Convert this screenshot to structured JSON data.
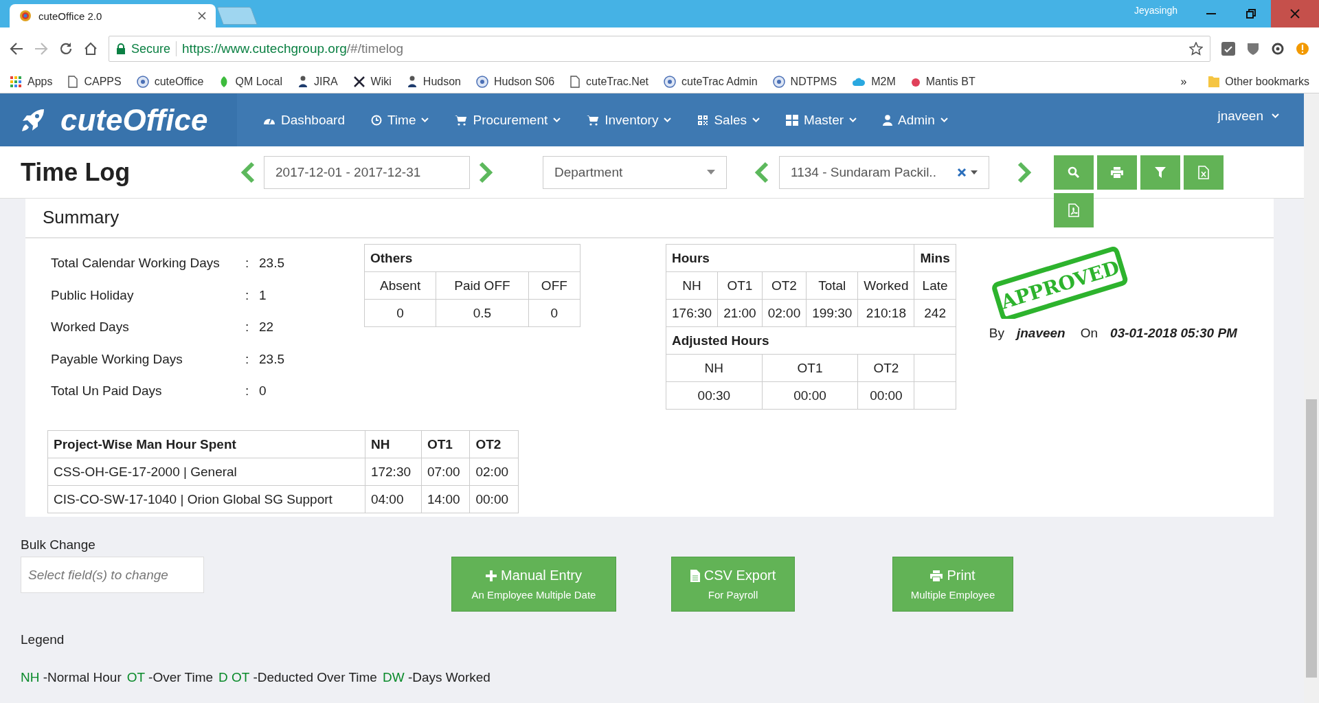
{
  "browser": {
    "tab_title": "cuteOffice 2.0",
    "profile": "Jeyasingh",
    "secure_label": "Secure",
    "url_host": "https://www.cutechgroup.org",
    "url_path": "/#/timelog",
    "bookmarks": [
      {
        "label": "Apps",
        "kind": "grid"
      },
      {
        "label": "CAPPS",
        "kind": "page"
      },
      {
        "label": "cuteOffice",
        "kind": "circle"
      },
      {
        "label": "QM Local",
        "kind": "leaf"
      },
      {
        "label": "JIRA",
        "kind": "figure"
      },
      {
        "label": "Wiki",
        "kind": "cross"
      },
      {
        "label": "Hudson",
        "kind": "figure"
      },
      {
        "label": "Hudson S06",
        "kind": "circle"
      },
      {
        "label": "cuteTrac.Net",
        "kind": "page"
      },
      {
        "label": "cuteTrac Admin",
        "kind": "circle"
      },
      {
        "label": "NDTPMS",
        "kind": "circle"
      },
      {
        "label": "M2M",
        "kind": "cloud"
      },
      {
        "label": "Mantis BT",
        "kind": "dot"
      }
    ],
    "overflow": "»",
    "other_bookmarks": "Other bookmarks"
  },
  "nav": {
    "brand": "cuteOffice",
    "items": [
      {
        "label": "Dashboard",
        "kind": "gauge",
        "dropdown": false
      },
      {
        "label": "Time",
        "kind": "clock",
        "dropdown": true
      },
      {
        "label": "Procurement",
        "kind": "cart",
        "dropdown": true
      },
      {
        "label": "Inventory",
        "kind": "cart",
        "dropdown": true
      },
      {
        "label": "Sales",
        "kind": "qr",
        "dropdown": true
      },
      {
        "label": "Master",
        "kind": "tiles",
        "dropdown": true
      },
      {
        "label": "Admin",
        "kind": "user",
        "dropdown": true
      }
    ],
    "user": "jnaveen"
  },
  "toolbar": {
    "title": "Time Log",
    "date_range": "2017-12-01 - 2017-12-31",
    "department_placeholder": "Department",
    "employee": "1134 - Sundaram Packil..",
    "actions": [
      {
        "kind": "search"
      },
      {
        "kind": "print"
      },
      {
        "kind": "filter"
      },
      {
        "kind": "excel"
      },
      {
        "kind": "pdf"
      }
    ]
  },
  "summary": {
    "title": "Summary",
    "stats": [
      {
        "label": "Total Calendar Working Days",
        "separator": ":",
        "value": "23.5"
      },
      {
        "label": "Public Holiday",
        "separator": ":",
        "value": "1"
      },
      {
        "label": "Worked Days",
        "separator": ":",
        "value": "22"
      },
      {
        "label": "Payable Working Days",
        "separator": ":",
        "value": "23.5"
      },
      {
        "label": "Total Un Paid Days",
        "separator": ":",
        "value": "0"
      }
    ],
    "others": {
      "title": "Others",
      "columns": [
        "Absent",
        "Paid OFF",
        "OFF"
      ],
      "values": [
        "0",
        "0.5",
        "0"
      ]
    },
    "hours": {
      "title": "Hours",
      "mins_title": "Mins",
      "columns": [
        "NH",
        "OT1",
        "OT2",
        "Total",
        "Worked",
        "Late"
      ],
      "values": [
        "176:30",
        "21:00",
        "02:00",
        "199:30",
        "210:18",
        "242"
      ],
      "adjusted_title": "Adjusted Hours",
      "adjusted_columns": [
        "NH",
        "OT1",
        "OT2"
      ],
      "adjusted_values": [
        "00:30",
        "00:00",
        "00:00"
      ]
    },
    "approval": {
      "stamp": "APPROVED",
      "by_label": "By",
      "by": "jnaveen",
      "on_label": "On",
      "on": "03-01-2018 05:30 PM"
    },
    "projects": {
      "columns": [
        "Project-Wise Man Hour Spent",
        "NH",
        "OT1",
        "OT2"
      ],
      "rows": [
        [
          "CSS-OH-GE-17-2000 | General",
          "172:30",
          "07:00",
          "02:00"
        ],
        [
          "CIS-CO-SW-17-1040 | Orion Global SG Support",
          "04:00",
          "14:00",
          "00:00"
        ]
      ]
    }
  },
  "bulk_change": {
    "label": "Bulk Change",
    "placeholder": "Select field(s) to change"
  },
  "actions": [
    {
      "kind": "plus",
      "title": "Manual Entry",
      "subtitle": "An Employee Multiple Date"
    },
    {
      "kind": "file",
      "title": "CSV Export",
      "subtitle": "For Payroll"
    },
    {
      "kind": "print",
      "title": "Print",
      "subtitle": "Multiple Employee"
    }
  ],
  "legend": {
    "title": "Legend",
    "items": [
      {
        "code": "NH",
        "meaning": "-Normal Hour"
      },
      {
        "code": "OT",
        "meaning": "-Over Time"
      },
      {
        "code": "D OT",
        "meaning": "-Deducted Over Time"
      },
      {
        "code": "DW",
        "meaning": "-Days Worked"
      }
    ]
  }
}
